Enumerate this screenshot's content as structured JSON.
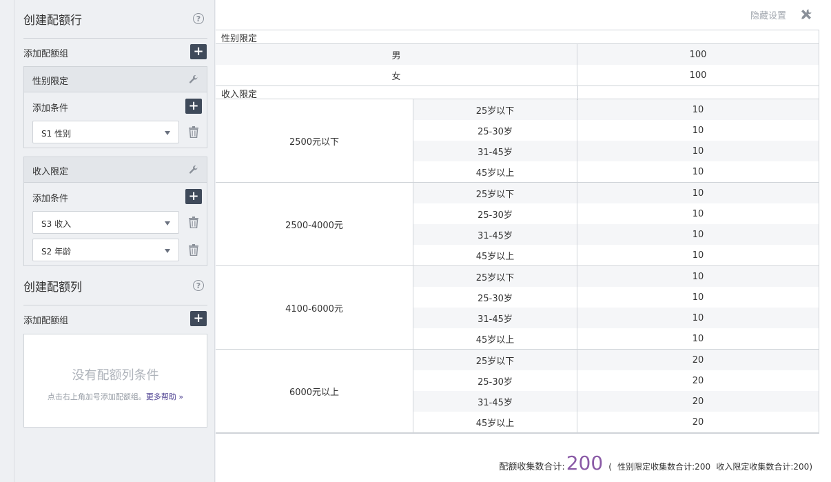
{
  "rows_panel": {
    "title": "创建配额行",
    "add_group_label": "添加配额组",
    "groups": [
      {
        "title": "性别限定",
        "add_condition_label": "添加条件",
        "conditions": [
          "S1 性别"
        ]
      },
      {
        "title": "收入限定",
        "add_condition_label": "添加条件",
        "conditions": [
          "S3 收入",
          "S2 年龄"
        ]
      }
    ]
  },
  "cols_panel": {
    "title": "创建配额列",
    "add_group_label": "添加配额组",
    "empty_title": "没有配额列条件",
    "empty_hint": "点击右上角加号添加配额组。",
    "help_link": "更多帮助 »"
  },
  "header": {
    "hide_settings_label": "隐藏设置",
    "icon": "tools-icon"
  },
  "table": {
    "gender_section": {
      "label": "性别限定",
      "rows": [
        {
          "name": "男",
          "value": "100"
        },
        {
          "name": "女",
          "value": "100"
        }
      ]
    },
    "income_section": {
      "label": "收入限定",
      "groups": [
        {
          "label": "2500元以下",
          "rows": [
            {
              "age": "25岁以下",
              "value": "10"
            },
            {
              "age": "25-30岁",
              "value": "10"
            },
            {
              "age": "31-45岁",
              "value": "10"
            },
            {
              "age": "45岁以上",
              "value": "10"
            }
          ]
        },
        {
          "label": "2500-4000元",
          "rows": [
            {
              "age": "25岁以下",
              "value": "10"
            },
            {
              "age": "25-30岁",
              "value": "10"
            },
            {
              "age": "31-45岁",
              "value": "10"
            },
            {
              "age": "45岁以上",
              "value": "10"
            }
          ]
        },
        {
          "label": "4100-6000元",
          "rows": [
            {
              "age": "25岁以下",
              "value": "10"
            },
            {
              "age": "25-30岁",
              "value": "10"
            },
            {
              "age": "31-45岁",
              "value": "10"
            },
            {
              "age": "45岁以上",
              "value": "10"
            }
          ]
        },
        {
          "label": "6000元以上",
          "rows": [
            {
              "age": "25岁以下",
              "value": "20"
            },
            {
              "age": "25-30岁",
              "value": "20"
            },
            {
              "age": "31-45岁",
              "value": "20"
            },
            {
              "age": "45岁以上",
              "value": "20"
            }
          ]
        }
      ]
    }
  },
  "summary": {
    "label": "配额收集数合计:",
    "total": "200",
    "open_paren": "(",
    "gender_total_label": "性别限定收集数合计:200",
    "income_total_label": "收入限定收集数合计:200",
    "close_paren": ")"
  },
  "colors": {
    "accent_purple": "#8a5aa6",
    "button_dark": "#3f4a5a",
    "link": "#4a3d8f"
  }
}
